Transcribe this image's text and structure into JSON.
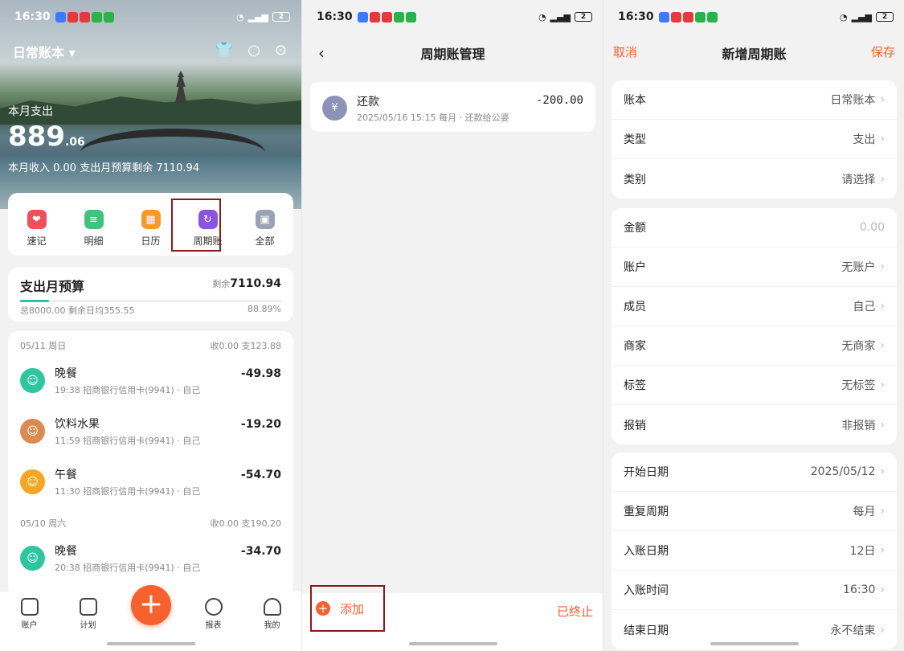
{
  "status": {
    "time": "16:30",
    "battery": "2"
  },
  "home": {
    "book_title": "日常账本",
    "month_label": "本月支出",
    "month_amount_int": "889",
    "month_amount_dec": ".06",
    "month_sub": "本月收入 0.00    支出月预算剩余 7110.94",
    "quick": [
      {
        "label": "速记",
        "color": "#ef4e5a",
        "glyph": "❤"
      },
      {
        "label": "明细",
        "color": "#3cc47c",
        "glyph": "≡"
      },
      {
        "label": "日历",
        "color": "#f59a2a",
        "glyph": "▦"
      },
      {
        "label": "周期账",
        "color": "#8a54e0",
        "glyph": "↻"
      },
      {
        "label": "全部",
        "color": "#9aa3b5",
        "glyph": "▣"
      }
    ],
    "budget": {
      "title": "支出月预算",
      "remain_label": "剩余",
      "remain_value": "7110.94",
      "left": "总8000.00  剩余日均355.55",
      "right": "88.89%"
    },
    "days": [
      {
        "date": "05/11 周日",
        "summary": "收0.00 支123.88",
        "items": [
          {
            "name": "晚餐",
            "sub": "19:38 招商银行信用卡(9941) · 自己",
            "amount": "-49.98",
            "color": "#2fc59f"
          },
          {
            "name": "饮料水果",
            "sub": "11:59 招商银行信用卡(9941) · 自己",
            "amount": "-19.20",
            "color": "#d98b52"
          },
          {
            "name": "午餐",
            "sub": "11:30 招商银行信用卡(9941) · 自己",
            "amount": "-54.70",
            "color": "#f5a623"
          }
        ]
      },
      {
        "date": "05/10 周六",
        "summary": "收0.00 支190.20",
        "items": [
          {
            "name": "晚餐",
            "sub": "20:38 招商银行信用卡(9941) · 自己",
            "amount": "-34.70",
            "color": "#2fc59f"
          }
        ]
      }
    ],
    "tabs": [
      "账户",
      "计划",
      "报表",
      "我的"
    ]
  },
  "periodic": {
    "title": "周期账管理",
    "item": {
      "name": "还款",
      "sub": "2025/05/16 15:15 每月 · 还款给公婆",
      "amount": "-200.00"
    },
    "add_label": "添加",
    "ended_label": "已终止"
  },
  "new": {
    "cancel": "取消",
    "title": "新增周期账",
    "save": "保存",
    "groups": [
      [
        {
          "k": "账本",
          "v": "日常账本"
        },
        {
          "k": "类型",
          "v": "支出"
        },
        {
          "k": "类别",
          "v": "请选择"
        }
      ],
      [
        {
          "k": "金额",
          "v": "0.00",
          "placeholder": true
        },
        {
          "k": "账户",
          "v": "无账户"
        },
        {
          "k": "成员",
          "v": "自己"
        },
        {
          "k": "商家",
          "v": "无商家"
        },
        {
          "k": "标签",
          "v": "无标签"
        },
        {
          "k": "报销",
          "v": "非报销"
        }
      ],
      [
        {
          "k": "开始日期",
          "v": "2025/05/12"
        },
        {
          "k": "重复周期",
          "v": "每月"
        },
        {
          "k": "入账日期",
          "v": "12日"
        },
        {
          "k": "入账时间",
          "v": "16:30"
        },
        {
          "k": "结束日期",
          "v": "永不结束"
        }
      ]
    ]
  }
}
